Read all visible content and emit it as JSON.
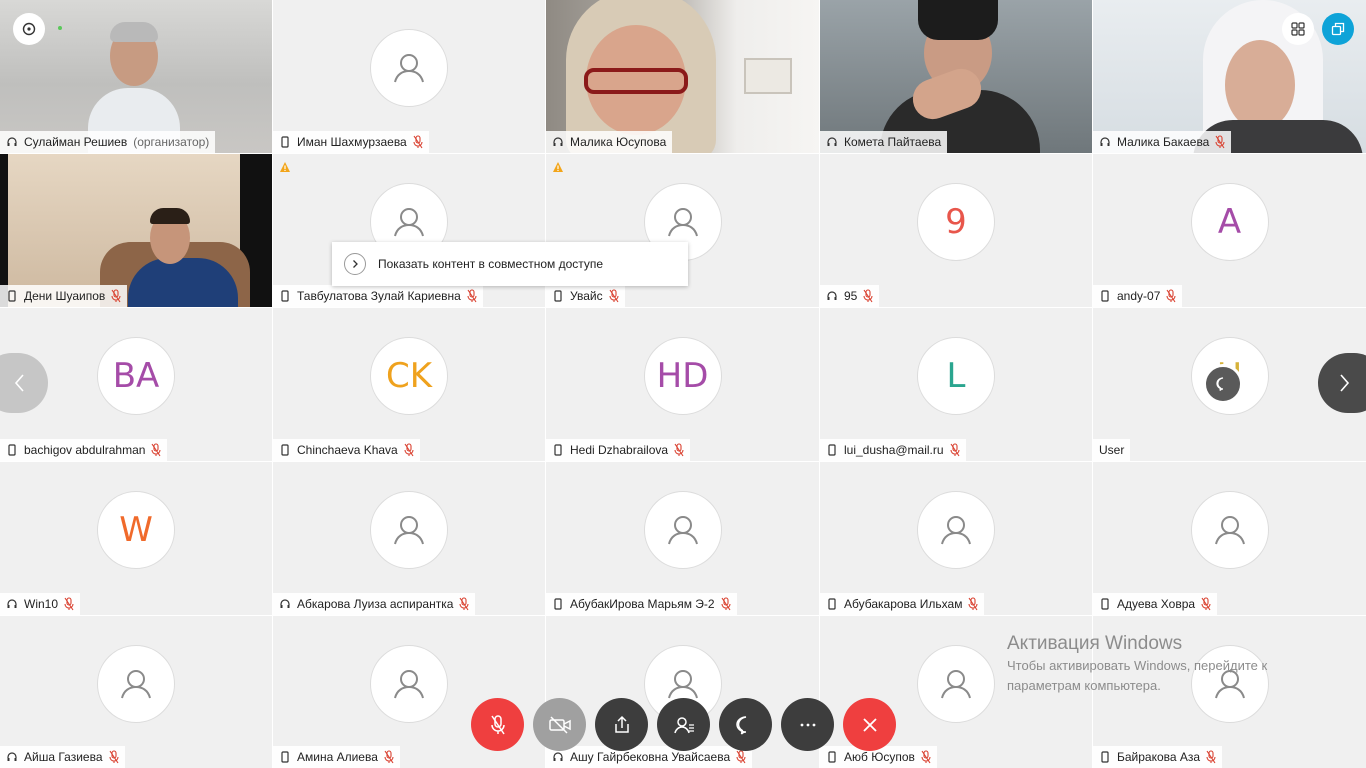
{
  "participants": [
    {
      "name": "Сулайман Решиев",
      "suffix": "(организатор)",
      "device": "headset",
      "muted": false,
      "avatar": null
    },
    {
      "name": "Иман Шахмурзаева",
      "device": "phone",
      "muted": true,
      "avatar": "default"
    },
    {
      "name": "Малика Юсупова",
      "device": "headset",
      "muted": false,
      "avatar": null
    },
    {
      "name": "Комета Пайтаева",
      "device": "headset",
      "muted": false,
      "avatar": null
    },
    {
      "name": "Малика Бакаева",
      "device": "headset",
      "muted": true,
      "avatar": null
    },
    {
      "name": "Дени Шуаипов",
      "device": "phone",
      "muted": true,
      "avatar": null
    },
    {
      "name": "Тавбулатова Зулай Кариевна",
      "device": "phone",
      "muted": true,
      "avatar": "default",
      "warning": true
    },
    {
      "name": "Увайс",
      "device": "phone",
      "muted": true,
      "avatar": "default",
      "warning": true
    },
    {
      "name": "95",
      "device": "headset",
      "muted": true,
      "avatar_text": "9",
      "avatar_color": "#e8564b"
    },
    {
      "name": "andy-07",
      "device": "phone",
      "muted": true,
      "avatar_text": "A",
      "avatar_color": "#a54ca8"
    },
    {
      "name": "bachigov abdulrahman",
      "device": "phone",
      "muted": true,
      "avatar_text": "BA",
      "avatar_color": "#a54ca8"
    },
    {
      "name": "Chinchaeva Khava",
      "device": "phone",
      "muted": true,
      "avatar_text": "CK",
      "avatar_color": "#efa21e"
    },
    {
      "name": "Hedi Dzhabrailova",
      "device": "phone",
      "muted": true,
      "avatar_text": "HD",
      "avatar_color": "#a54ca8"
    },
    {
      "name": "lui_dusha@mail.ru",
      "device": "phone",
      "muted": true,
      "avatar_text": "L",
      "avatar_color": "#2aa58f"
    },
    {
      "name": "User",
      "device": "none",
      "muted": false,
      "avatar_text": "U",
      "avatar_color": "#d6b23a"
    },
    {
      "name": "Win10",
      "device": "headset",
      "muted": true,
      "avatar_text": "W",
      "avatar_color": "#f06a2b"
    },
    {
      "name": "Абкарова Луиза аспирантка",
      "device": "headset",
      "muted": true,
      "avatar": "default"
    },
    {
      "name": "АбубакИрова Марьям Э-2",
      "device": "phone",
      "muted": true,
      "avatar": "default"
    },
    {
      "name": "Абубакарова Ильхам",
      "device": "phone",
      "muted": true,
      "avatar": "default"
    },
    {
      "name": "Адуева Ховра",
      "device": "phone",
      "muted": true,
      "avatar": "default"
    },
    {
      "name": "Айша Газиева",
      "device": "headset",
      "muted": true,
      "avatar": "default"
    },
    {
      "name": "Амина Алиева",
      "device": "phone",
      "muted": true,
      "avatar": "default"
    },
    {
      "name": "Ашу Гайрбековна Увайсаева",
      "device": "headset",
      "muted": true,
      "avatar": "default"
    },
    {
      "name": "Аюб Юсупов",
      "device": "phone",
      "muted": true,
      "avatar": "default"
    },
    {
      "name": "Байракова Аза",
      "device": "phone",
      "muted": true,
      "avatar": "default"
    }
  ],
  "popup": {
    "text": "Показать контент в совместном доступе"
  },
  "watermark": {
    "title": "Активация Windows",
    "line1": "Чтобы активировать Windows, перейдите к",
    "line2": "параметрам компьютера."
  },
  "colors": {
    "accent": "#0ea3d8",
    "end_call": "#ef3f3f",
    "muted_icon": "#d9402f",
    "active_border": "#1fa0d6"
  },
  "controls": [
    "mic-muted-icon",
    "video-off-icon",
    "share-icon",
    "participants-icon",
    "chat-icon",
    "more-icon",
    "hangup-icon"
  ]
}
